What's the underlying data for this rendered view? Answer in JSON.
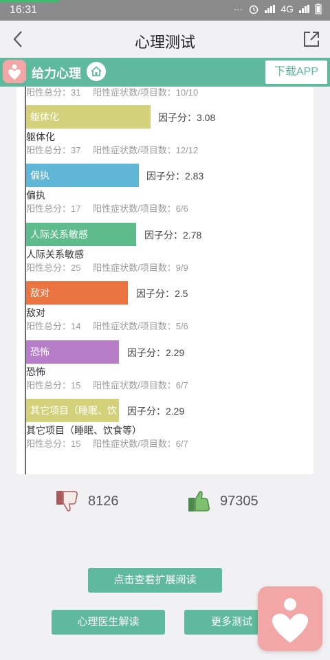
{
  "status_bar": {
    "time": "16:31",
    "network": "4G"
  },
  "header": {
    "title": "心理测试"
  },
  "banner": {
    "brand": "给力心理",
    "download_label": "下载APP"
  },
  "card": {
    "partial_stats": {
      "positive_total": "阳性总分：31",
      "ratio": "阳性症状数/项目数：10/10"
    },
    "factors": [
      {
        "bar_label": "躯体化",
        "score": "因子分：3.08",
        "name": "躯体化",
        "positive_total": "阳性总分：37",
        "ratio": "阳性症状数/项目数：12/12",
        "color": "#d3d27a",
        "score_value": 3.08
      },
      {
        "bar_label": "偏执",
        "score": "因子分：2.83",
        "name": "偏执",
        "positive_total": "阳性总分：17",
        "ratio": "阳性症状数/项目数：6/6",
        "color": "#5fb6d6",
        "score_value": 2.83
      },
      {
        "bar_label": "人际关系敏感",
        "score": "因子分：2.78",
        "name": "人际关系敏感",
        "positive_total": "阳性总分：25",
        "ratio": "阳性症状数/项目数：9/9",
        "color": "#5ebc8c",
        "score_value": 2.78
      },
      {
        "bar_label": "敌对",
        "score": "因子分：2.5",
        "name": "敌对",
        "positive_total": "阳性总分：14",
        "ratio": "阳性症状数/项目数：5/6",
        "color": "#ec7440",
        "score_value": 2.5
      },
      {
        "bar_label": "恐怖",
        "score": "因子分：2.29",
        "name": "恐怖",
        "positive_total": "阳性总分：15",
        "ratio": "阳性症状数/项目数：6/7",
        "color": "#b77dc8",
        "score_value": 2.29
      },
      {
        "bar_label": "其它项目（睡眠、饮",
        "score": "因子分：2.29",
        "name": "其它项目（睡眠、饮食等）",
        "positive_total": "阳性总分：15",
        "ratio": "阳性症状数/项目数：6/7",
        "color": "#d3d27a",
        "score_value": 2.29
      }
    ]
  },
  "votes": {
    "dislike_count": "8126",
    "like_count": "97305"
  },
  "buttons": {
    "extended_reading": "点击查看扩展阅读",
    "doctor_reading": "心理医生解读",
    "more_tests": "更多测试"
  }
}
